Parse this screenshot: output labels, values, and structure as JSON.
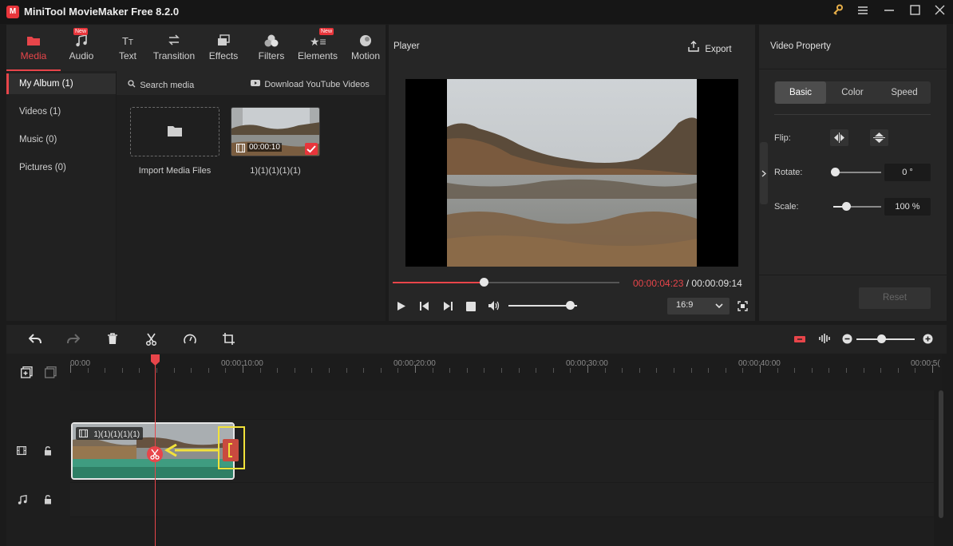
{
  "app": {
    "title": "MiniTool MovieMaker Free 8.2.0",
    "logo_letter": "M"
  },
  "titlebar": {
    "icons": [
      "key-icon",
      "menu-icon",
      "minimize-icon",
      "maximize-icon",
      "close-icon"
    ]
  },
  "toolbar": {
    "items": [
      {
        "label": "Media",
        "icon": "folder-icon",
        "active": true,
        "new": false
      },
      {
        "label": "Audio",
        "icon": "music-icon",
        "active": false,
        "new": true
      },
      {
        "label": "Text",
        "icon": "text-icon",
        "active": false,
        "new": false
      },
      {
        "label": "Transition",
        "icon": "transition-icon",
        "active": false,
        "new": false
      },
      {
        "label": "Effects",
        "icon": "effects-icon",
        "active": false,
        "new": false
      },
      {
        "label": "Filters",
        "icon": "filters-icon",
        "active": false,
        "new": false
      },
      {
        "label": "Elements",
        "icon": "elements-icon",
        "active": false,
        "new": true
      },
      {
        "label": "Motion",
        "icon": "motion-icon",
        "active": false,
        "new": false
      }
    ],
    "new_badge": "New"
  },
  "library": {
    "items": [
      "My Album (1)",
      "Videos (1)",
      "Music (0)",
      "Pictures (0)"
    ],
    "search_label": "Search media",
    "download_label": "Download YouTube Videos",
    "import_label": "Import Media Files",
    "clip_name": "1)(1)(1)(1)(1)",
    "clip_duration": "00:00:10"
  },
  "player": {
    "title": "Player",
    "export_label": "Export",
    "current_time": "00:00:04:23",
    "total_time": " / 00:00:09:14",
    "progress": 0.4,
    "volume": 0.9,
    "aspect": "16:9"
  },
  "props": {
    "title": "Video Property",
    "tabs": [
      "Basic",
      "Color",
      "Speed"
    ],
    "flip_label": "Flip:",
    "rotate_label": "Rotate:",
    "rotate_value": "0 °",
    "scale_label": "Scale:",
    "scale_value": "100 %",
    "reset_label": "Reset"
  },
  "timeline": {
    "ruler": [
      "00:00",
      "00:00:10:00",
      "00:00:20:00",
      "00:00:30:00",
      "00:00:40:00",
      "00:00:5("
    ],
    "clip_label": "1)(1)(1)(1)(1)",
    "accent": "#e8454a"
  }
}
